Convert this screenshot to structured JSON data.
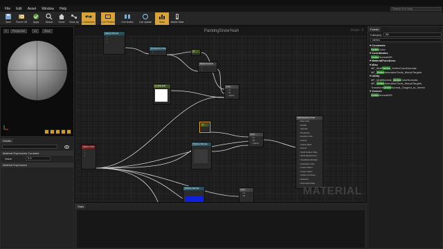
{
  "menu": [
    "File",
    "Edit",
    "Asset",
    "Window",
    "Help"
  ],
  "search": {
    "placeholder": "Search For Help"
  },
  "toolbar": [
    {
      "label": "Save",
      "icon": "save-icon"
    },
    {
      "label": "Find in CB",
      "icon": "find-icon"
    },
    {
      "label": "Apply",
      "icon": "apply-icon"
    },
    {
      "label": "Search",
      "icon": "search-icon"
    },
    {
      "label": "Home",
      "icon": "home-icon"
    },
    {
      "label": "Clean Up",
      "icon": "cleanup-icon"
    },
    {
      "label": "Connectors",
      "icon": "connectors-icon"
    },
    {
      "label": "Live Preview",
      "icon": "live-preview-icon"
    },
    {
      "label": "Live Nodes",
      "icon": "live-nodes-icon"
    },
    {
      "label": "Live Update",
      "icon": "live-update-icon"
    },
    {
      "label": "Stats",
      "icon": "stats-icon"
    },
    {
      "label": "Mobile Stats",
      "icon": "mobile-stats-icon"
    }
  ],
  "viewport": {
    "perspective_label": "Perspective",
    "lit_label": "Lit",
    "show_label": "Show"
  },
  "details": {
    "tab": "Details",
    "section1": "Material Expression Constant",
    "value_label": "Value",
    "value": "0.0",
    "section2": "Material Expression"
  },
  "graph": {
    "title": "PaintingSnowYeah",
    "zoom": "Zoom -3",
    "watermark": "MATERIAL",
    "nodes": {
      "vertex_normal": "Vertex Normal",
      "component_mask": "Component Mask",
      "constant": "0",
      "world_position": "World Position",
      "multiply": "Multiply",
      "vector_param": "V_Mtl4 R/B",
      "lerp_top": "Lerp",
      "constant2": "0",
      "vertex_color": "Vertex Color",
      "texture_sample1": "Texture Sample",
      "lerp_mid": "Lerp",
      "texture_sample2": "Texture Sample",
      "lerp_bottom": "Lerp",
      "material": "PaintingSnowYeah",
      "material_pins": [
        "Base Color",
        "Metallic",
        "Specular",
        "Roughness",
        "Emissive Color",
        "Opacity",
        "Opacity Mask",
        "Normal",
        "World Position Offset",
        "World Displacement",
        "Tessellation Multiplier",
        "Subsurface Color",
        "Custom Data 0",
        "Custom Data 1",
        "Ambient Occlusion",
        "Refraction",
        "Pixel Depth Offset"
      ]
    }
  },
  "palette": {
    "tab": "Palette",
    "category_label": "Category",
    "category_value": "All",
    "search_value": "vertex",
    "groups": [
      {
        "name": "Constants",
        "items": [
          "VertexColor"
        ]
      },
      {
        "name": "Coordinates",
        "items": [
          "VertexNormalWS"
        ]
      },
      {
        "name": "MaterialFunctions",
        "items": []
      },
      {
        "name": "Misc",
        "items": [
          "MF_MultiVertex_VertexColorNormals",
          "MF_VertexAnimationTools_MorphTargets"
        ]
      },
      {
        "name": "Utility",
        "items": [
          "MF_MultiNormal_VertexColorNormals",
          "MF_VertexAnimationTools_MorphTargets",
          "TransformVertexNormal_Tangent_to_Vertex"
        ]
      },
      {
        "name": "Vectors",
        "items": [
          "VertexNormalWS"
        ]
      }
    ]
  },
  "stats": {
    "tab": "Stats"
  },
  "colors": {
    "accent": "#d8a43a",
    "highlight": "#2e7a2e",
    "selected": "#f2a21a"
  }
}
